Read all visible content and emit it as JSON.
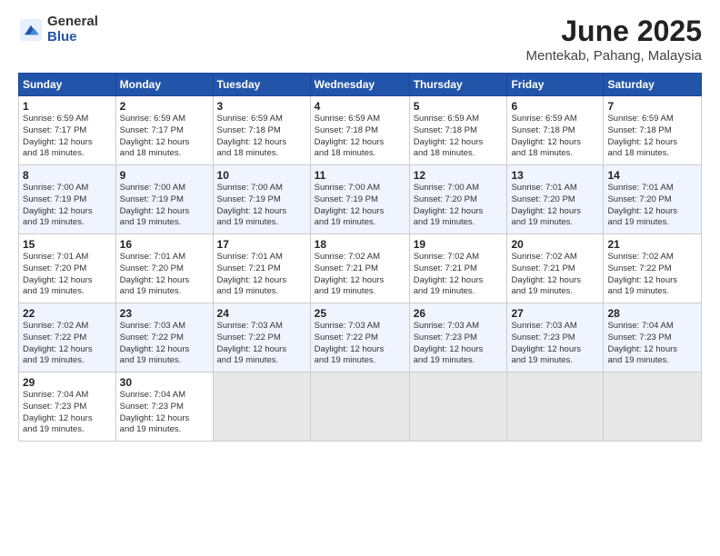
{
  "logo": {
    "general": "General",
    "blue": "Blue"
  },
  "title": {
    "month": "June 2025",
    "location": "Mentekab, Pahang, Malaysia"
  },
  "weekdays": [
    "Sunday",
    "Monday",
    "Tuesday",
    "Wednesday",
    "Thursday",
    "Friday",
    "Saturday"
  ],
  "weeks": [
    [
      {
        "day": "1",
        "sunrise": "6:59 AM",
        "sunset": "7:17 PM",
        "daylight": "12 hours and 18 minutes."
      },
      {
        "day": "2",
        "sunrise": "6:59 AM",
        "sunset": "7:17 PM",
        "daylight": "12 hours and 18 minutes."
      },
      {
        "day": "3",
        "sunrise": "6:59 AM",
        "sunset": "7:18 PM",
        "daylight": "12 hours and 18 minutes."
      },
      {
        "day": "4",
        "sunrise": "6:59 AM",
        "sunset": "7:18 PM",
        "daylight": "12 hours and 18 minutes."
      },
      {
        "day": "5",
        "sunrise": "6:59 AM",
        "sunset": "7:18 PM",
        "daylight": "12 hours and 18 minutes."
      },
      {
        "day": "6",
        "sunrise": "6:59 AM",
        "sunset": "7:18 PM",
        "daylight": "12 hours and 18 minutes."
      },
      {
        "day": "7",
        "sunrise": "6:59 AM",
        "sunset": "7:18 PM",
        "daylight": "12 hours and 18 minutes."
      }
    ],
    [
      {
        "day": "8",
        "sunrise": "7:00 AM",
        "sunset": "7:19 PM",
        "daylight": "12 hours and 19 minutes."
      },
      {
        "day": "9",
        "sunrise": "7:00 AM",
        "sunset": "7:19 PM",
        "daylight": "12 hours and 19 minutes."
      },
      {
        "day": "10",
        "sunrise": "7:00 AM",
        "sunset": "7:19 PM",
        "daylight": "12 hours and 19 minutes."
      },
      {
        "day": "11",
        "sunrise": "7:00 AM",
        "sunset": "7:19 PM",
        "daylight": "12 hours and 19 minutes."
      },
      {
        "day": "12",
        "sunrise": "7:00 AM",
        "sunset": "7:20 PM",
        "daylight": "12 hours and 19 minutes."
      },
      {
        "day": "13",
        "sunrise": "7:01 AM",
        "sunset": "7:20 PM",
        "daylight": "12 hours and 19 minutes."
      },
      {
        "day": "14",
        "sunrise": "7:01 AM",
        "sunset": "7:20 PM",
        "daylight": "12 hours and 19 minutes."
      }
    ],
    [
      {
        "day": "15",
        "sunrise": "7:01 AM",
        "sunset": "7:20 PM",
        "daylight": "12 hours and 19 minutes."
      },
      {
        "day": "16",
        "sunrise": "7:01 AM",
        "sunset": "7:20 PM",
        "daylight": "12 hours and 19 minutes."
      },
      {
        "day": "17",
        "sunrise": "7:01 AM",
        "sunset": "7:21 PM",
        "daylight": "12 hours and 19 minutes."
      },
      {
        "day": "18",
        "sunrise": "7:02 AM",
        "sunset": "7:21 PM",
        "daylight": "12 hours and 19 minutes."
      },
      {
        "day": "19",
        "sunrise": "7:02 AM",
        "sunset": "7:21 PM",
        "daylight": "12 hours and 19 minutes."
      },
      {
        "day": "20",
        "sunrise": "7:02 AM",
        "sunset": "7:21 PM",
        "daylight": "12 hours and 19 minutes."
      },
      {
        "day": "21",
        "sunrise": "7:02 AM",
        "sunset": "7:22 PM",
        "daylight": "12 hours and 19 minutes."
      }
    ],
    [
      {
        "day": "22",
        "sunrise": "7:02 AM",
        "sunset": "7:22 PM",
        "daylight": "12 hours and 19 minutes."
      },
      {
        "day": "23",
        "sunrise": "7:03 AM",
        "sunset": "7:22 PM",
        "daylight": "12 hours and 19 minutes."
      },
      {
        "day": "24",
        "sunrise": "7:03 AM",
        "sunset": "7:22 PM",
        "daylight": "12 hours and 19 minutes."
      },
      {
        "day": "25",
        "sunrise": "7:03 AM",
        "sunset": "7:22 PM",
        "daylight": "12 hours and 19 minutes."
      },
      {
        "day": "26",
        "sunrise": "7:03 AM",
        "sunset": "7:23 PM",
        "daylight": "12 hours and 19 minutes."
      },
      {
        "day": "27",
        "sunrise": "7:03 AM",
        "sunset": "7:23 PM",
        "daylight": "12 hours and 19 minutes."
      },
      {
        "day": "28",
        "sunrise": "7:04 AM",
        "sunset": "7:23 PM",
        "daylight": "12 hours and 19 minutes."
      }
    ],
    [
      {
        "day": "29",
        "sunrise": "7:04 AM",
        "sunset": "7:23 PM",
        "daylight": "12 hours and 19 minutes."
      },
      {
        "day": "30",
        "sunrise": "7:04 AM",
        "sunset": "7:23 PM",
        "daylight": "12 hours and 19 minutes."
      },
      null,
      null,
      null,
      null,
      null
    ]
  ],
  "labels": {
    "sunrise": "Sunrise:",
    "sunset": "Sunset:",
    "daylight": "Daylight:"
  }
}
